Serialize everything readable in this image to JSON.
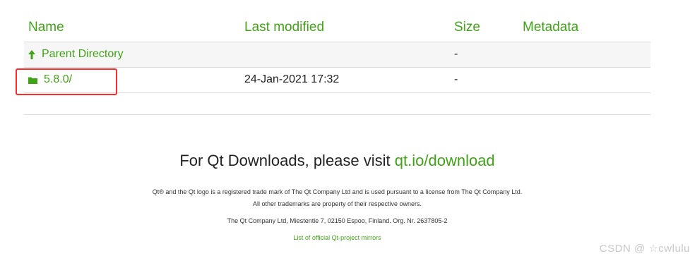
{
  "table": {
    "headers": {
      "name": "Name",
      "last_modified": "Last modified",
      "size": "Size",
      "metadata": "Metadata"
    },
    "rows": [
      {
        "icon": "up-arrow-icon",
        "name": "Parent Directory",
        "last_modified": "",
        "size": "-"
      },
      {
        "icon": "folder-icon",
        "name": "5.8.0/",
        "last_modified": "24-Jan-2021 17:32",
        "size": "-"
      }
    ]
  },
  "visit": {
    "prefix": "For Qt Downloads, please visit ",
    "link": "qt.io/download"
  },
  "footer": {
    "trademark": "Qt® and the Qt logo is a registered trade mark of The Qt Company Ltd and is used pursuant to a license from The Qt Company Ltd.",
    "other_trademarks": "All other trademarks are property of their respective owners.",
    "company": "The Qt Company Ltd, Miestentie 7, 02150 Espoo, Finland. Org. Nr. 2637805-2",
    "mirrors_link": "List of official Qt-project mirrors"
  },
  "watermark": "CSDN @ ☆cwlulu",
  "colors": {
    "link_green": "#41a317",
    "highlight_red": "#ff2a2a"
  }
}
